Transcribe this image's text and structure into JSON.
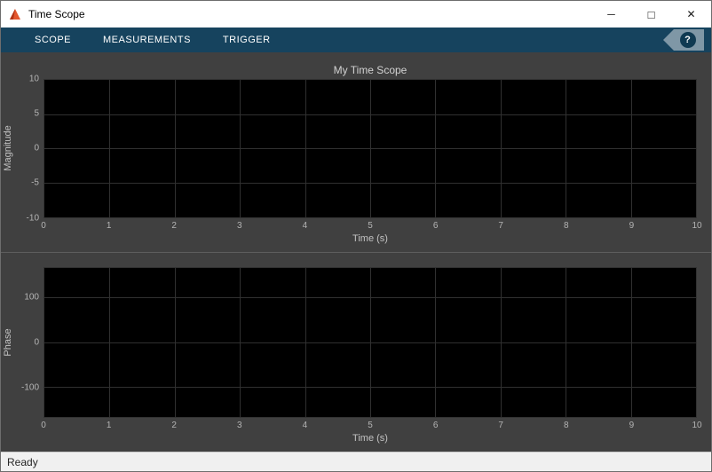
{
  "window": {
    "title": "Time Scope",
    "controls": {
      "minimize_icon": "─",
      "maximize_icon": "□",
      "close_icon": "✕"
    }
  },
  "toolstrip": {
    "tabs": [
      {
        "label": "SCOPE"
      },
      {
        "label": "MEASUREMENTS"
      },
      {
        "label": "TRIGGER"
      }
    ],
    "help_label": "?"
  },
  "plots": [
    {
      "title": "My Time Scope",
      "ylabel": "Magnitude",
      "xlabel": "Time (s)",
      "xlim": [
        0,
        10
      ],
      "ylim": [
        -10,
        10
      ],
      "yticks": [
        {
          "label": "10",
          "pos": 0
        },
        {
          "label": "5",
          "pos": 0.25
        },
        {
          "label": "0",
          "pos": 0.5
        },
        {
          "label": "-5",
          "pos": 0.75
        },
        {
          "label": "-10",
          "pos": 1
        }
      ],
      "xticks": [
        {
          "label": "0",
          "pos": 0
        },
        {
          "label": "1",
          "pos": 0.1
        },
        {
          "label": "2",
          "pos": 0.2
        },
        {
          "label": "3",
          "pos": 0.3
        },
        {
          "label": "4",
          "pos": 0.4
        },
        {
          "label": "5",
          "pos": 0.5
        },
        {
          "label": "6",
          "pos": 0.6
        },
        {
          "label": "7",
          "pos": 0.7
        },
        {
          "label": "8",
          "pos": 0.8
        },
        {
          "label": "9",
          "pos": 0.9
        },
        {
          "label": "10",
          "pos": 1
        }
      ]
    },
    {
      "title": "",
      "ylabel": "Phase",
      "xlabel": "Time (s)",
      "xlim": [
        0,
        10
      ],
      "yticks": [
        {
          "label": "100",
          "pos": 0.2
        },
        {
          "label": "0",
          "pos": 0.5
        },
        {
          "label": "-100",
          "pos": 0.8
        }
      ],
      "xticks": [
        {
          "label": "0",
          "pos": 0
        },
        {
          "label": "1",
          "pos": 0.1
        },
        {
          "label": "2",
          "pos": 0.2
        },
        {
          "label": "3",
          "pos": 0.3
        },
        {
          "label": "4",
          "pos": 0.4
        },
        {
          "label": "5",
          "pos": 0.5
        },
        {
          "label": "6",
          "pos": 0.6
        },
        {
          "label": "7",
          "pos": 0.7
        },
        {
          "label": "8",
          "pos": 0.8
        },
        {
          "label": "9",
          "pos": 0.9
        },
        {
          "label": "10",
          "pos": 1
        }
      ]
    }
  ],
  "statusbar": {
    "text": "Ready"
  },
  "colors": {
    "toolstrip_bg": "#16435e",
    "panel_bg": "#404040",
    "plot_bg": "#000000",
    "grid": "#303030",
    "tick_text": "#b4b4b4",
    "app_icon_orange": "#e4572e"
  }
}
